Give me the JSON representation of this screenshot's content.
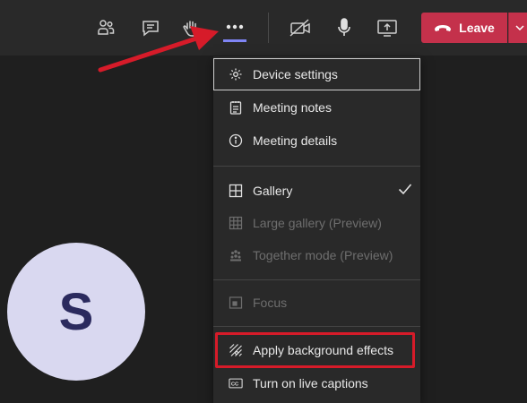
{
  "toolbar": {
    "icons": [
      "participants-icon",
      "chat-icon",
      "raise-hand-icon",
      "more-actions-icon",
      "camera-off-icon",
      "microphone-icon",
      "share-screen-icon"
    ],
    "leave_label": "Leave",
    "leave_color": "#c4314b"
  },
  "participant": {
    "initial": "S"
  },
  "menu": {
    "items": [
      {
        "label": "Device settings",
        "icon": "gear-icon"
      },
      {
        "label": "Meeting notes",
        "icon": "notes-icon"
      },
      {
        "label": "Meeting details",
        "icon": "info-icon"
      },
      {
        "label": "Gallery",
        "icon": "gallery-icon",
        "checked": true
      },
      {
        "label": "Large gallery (Preview)",
        "icon": "large-gallery-icon",
        "disabled": true
      },
      {
        "label": "Together mode (Preview)",
        "icon": "together-mode-icon",
        "disabled": true
      },
      {
        "label": "Focus",
        "icon": "focus-icon",
        "disabled": true
      },
      {
        "label": "Apply background effects",
        "icon": "background-effects-icon"
      },
      {
        "label": "Turn on live captions",
        "icon": "captions-icon"
      }
    ]
  },
  "annotation": {
    "arrow_color": "#d61b29",
    "highlight_color": "#d61b29"
  }
}
